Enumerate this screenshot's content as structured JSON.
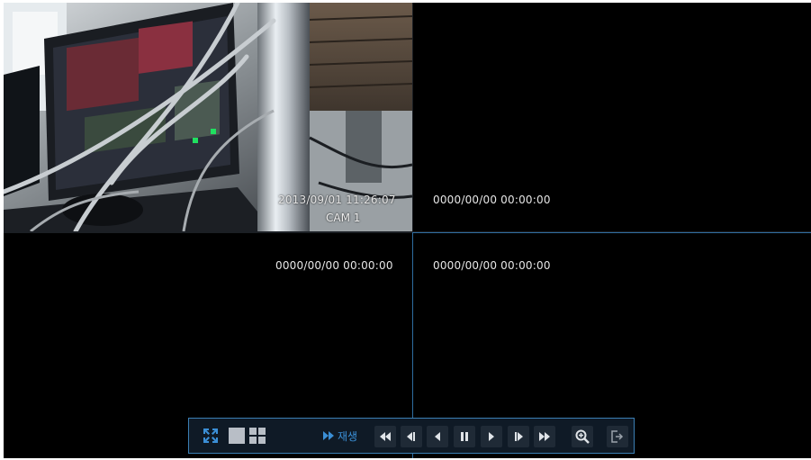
{
  "cameras": [
    {
      "name": "CAM 1",
      "timestamp": "2013/09/01 11:26:07"
    },
    {
      "name": "",
      "timestamp": "0000/00/00 00:00:00"
    },
    {
      "name": "",
      "timestamp": "0000/00/00 00:00:00"
    },
    {
      "name": "",
      "timestamp": "0000/00/00 00:00:00"
    }
  ],
  "toolbar": {
    "play_label": "재생",
    "accent_color": "#3b8fd6",
    "buttons": [
      {
        "name": "fullscreen-exit-icon"
      },
      {
        "name": "single-view-icon"
      },
      {
        "name": "quad-view-icon"
      },
      {
        "name": "fast-rewind-icon"
      },
      {
        "name": "step-back-icon"
      },
      {
        "name": "reverse-play-icon"
      },
      {
        "name": "pause-icon"
      },
      {
        "name": "play-icon"
      },
      {
        "name": "step-forward-icon"
      },
      {
        "name": "fast-forward-icon"
      },
      {
        "name": "zoom-in-icon"
      },
      {
        "name": "exit-icon"
      }
    ]
  }
}
